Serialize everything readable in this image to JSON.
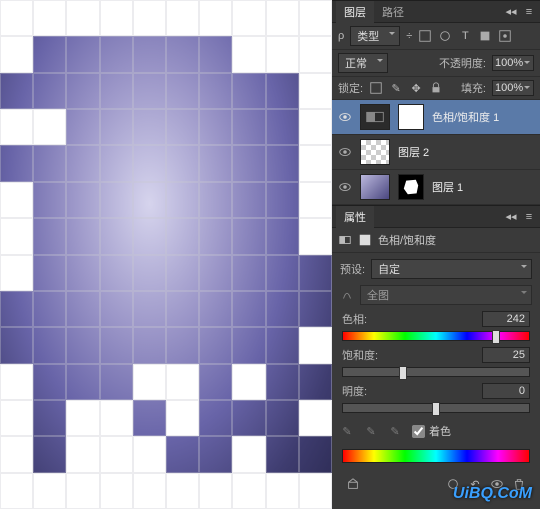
{
  "layers_panel": {
    "tabs": [
      "图层",
      "路径"
    ],
    "filter_label": "类型",
    "blend_mode": "正常",
    "opacity_label": "不透明度:",
    "opacity_value": "100%",
    "lock_label": "锁定:",
    "fill_label": "填充:",
    "fill_value": "100%",
    "layers": [
      {
        "name": "色相/饱和度 1"
      },
      {
        "name": "图层 2"
      },
      {
        "name": "图层 1"
      }
    ]
  },
  "properties_panel": {
    "tab": "属性",
    "adjustment_name": "色相/饱和度",
    "preset_label": "预设:",
    "preset_value": "自定",
    "channel_value": "全图",
    "sliders": {
      "hue": {
        "label": "色相:",
        "value": "242",
        "pos": 82
      },
      "sat": {
        "label": "饱和度:",
        "value": "25",
        "pos": 32
      },
      "light": {
        "label": "明度:",
        "value": "0",
        "pos": 50
      }
    },
    "colorize_label": "着色"
  },
  "watermark": "UiBQ.CoM",
  "white_cells": [
    0,
    1,
    2,
    3,
    4,
    5,
    6,
    7,
    8,
    9,
    10,
    17,
    18,
    19,
    29,
    30,
    31,
    39,
    49,
    50,
    59,
    60,
    69,
    70,
    99,
    100,
    104,
    105,
    107,
    110,
    112,
    113,
    115,
    119,
    120,
    122,
    123,
    124,
    127,
    130,
    131,
    132,
    133,
    134,
    135,
    136,
    137,
    138,
    139
  ]
}
